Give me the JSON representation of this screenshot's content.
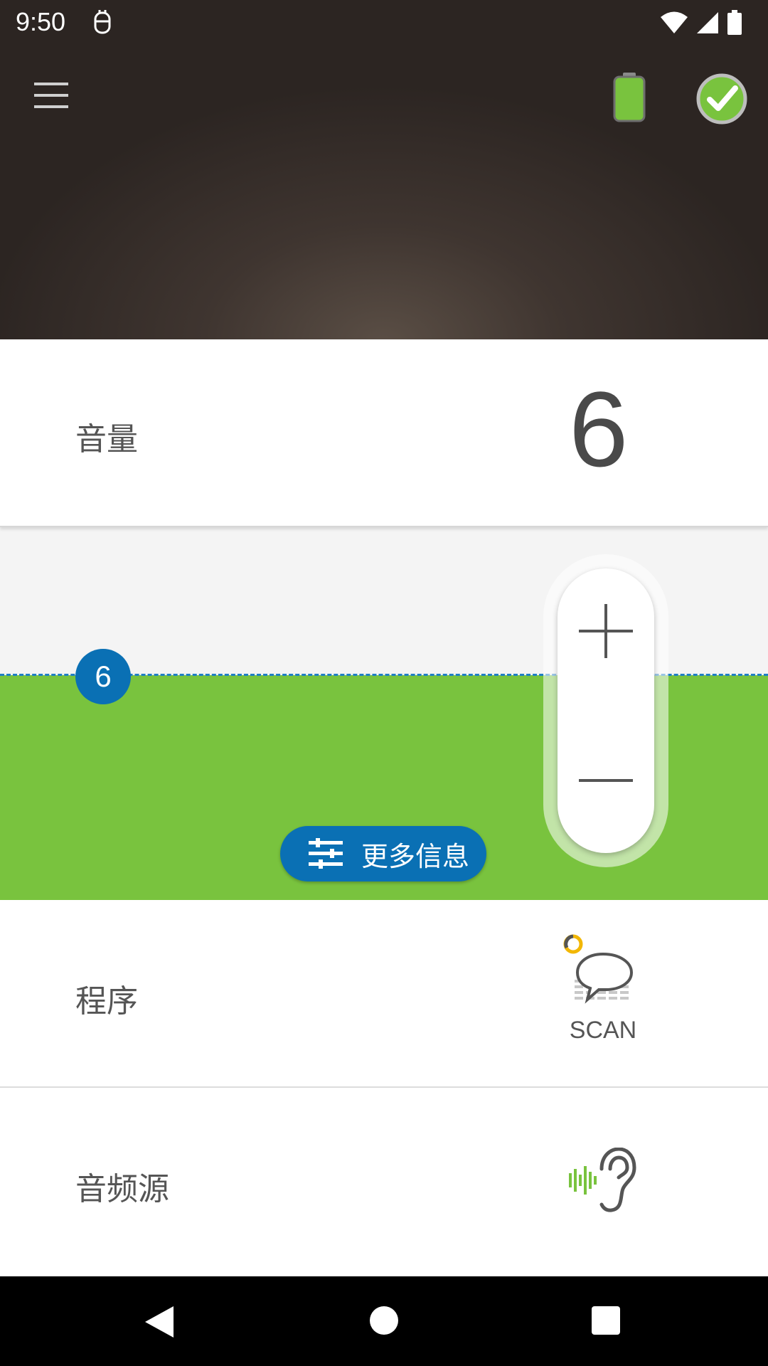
{
  "status_bar": {
    "time": "9:50",
    "icons": [
      "robot-notification-icon",
      "wifi-icon",
      "cell-signal-icon",
      "battery-icon"
    ]
  },
  "header": {
    "menu_icon": "hamburger-menu-icon",
    "battery_icon": "device-battery-icon",
    "connection_icon": "connected-check-icon",
    "colors": {
      "battery_green": "#79c33e",
      "check_green": "#79c33e"
    }
  },
  "volume": {
    "label": "音量",
    "value": "6",
    "level_badge": "6"
  },
  "slider": {
    "more_info_label": "更多信息",
    "more_info_icon": "sliders-icon",
    "plus_icon": "plus-icon",
    "minus_icon": "minus-icon",
    "colors": {
      "fill": "#79c33e",
      "accent": "#0a70b4",
      "track": "#f4f4f4"
    }
  },
  "program": {
    "label": "程序",
    "scan_label": "SCAN",
    "scan_icon": "speech-bubble-scan-icon"
  },
  "audio_source": {
    "label": "音频源",
    "icon": "ear-sound-icon"
  },
  "nav": {
    "back_icon": "back-triangle-icon",
    "home_icon": "home-circle-icon",
    "recent_icon": "recent-square-icon"
  }
}
